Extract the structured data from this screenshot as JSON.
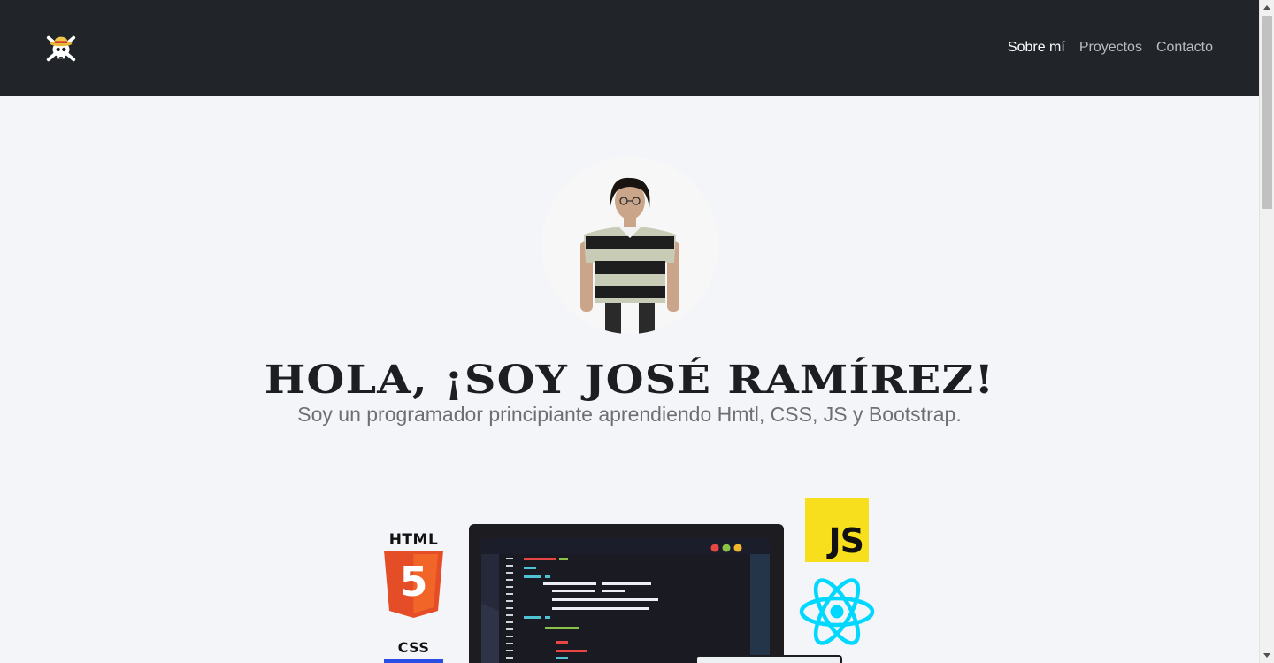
{
  "nav": {
    "logo_icon": "straw-hat-skull-icon",
    "links": [
      {
        "label": "Sobre mí",
        "active": true
      },
      {
        "label": "Proyectos",
        "active": false
      },
      {
        "label": "Contacto",
        "active": false
      }
    ]
  },
  "hero": {
    "photo": "profile-photo",
    "headline": "HOLA, ¡SOY JOSÉ RAMÍREZ!",
    "subtitle": "Soy un programador principiante aprendiendo Hmtl, CSS, JS y Bootstrap."
  },
  "tech": {
    "html_label": "HTML",
    "html_number": "5",
    "css_label": "CSS",
    "js_label": "JS",
    "react_icon": "react-atom-icon"
  },
  "colors": {
    "navbar": "#212529",
    "background": "#f4f5f8",
    "html5": "#e44d26",
    "js": "#f7df1e",
    "react": "#00d8ff"
  }
}
